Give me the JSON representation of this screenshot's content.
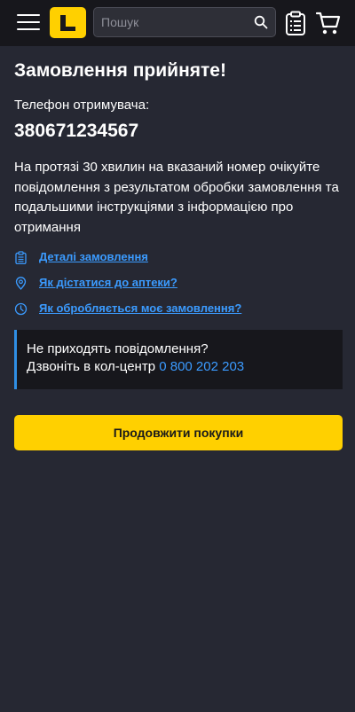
{
  "header": {
    "search": {
      "placeholder": "Пошук",
      "value": ""
    },
    "icons": {
      "menu": "hamburger-icon",
      "logo": "brand-logo",
      "search": "search-icon",
      "orders": "clipboard-list-icon",
      "cart": "cart-icon"
    }
  },
  "main": {
    "title": "Замовлення прийняте!",
    "phone_label": "Телефон отримувача:",
    "phone_number": "380671234567",
    "message": "На протязі 30 хвилин на вказаний номер очікуйте повідомлення з результатом обробки замовлення та подальшими інструкціями з інформацією про отримання",
    "links": [
      {
        "label": "Деталі замовлення",
        "icon": "clipboard-icon"
      },
      {
        "label": "Як дістатися до аптеки?",
        "icon": "location-pin-icon"
      },
      {
        "label": "Як обробляється моє замовлення?",
        "icon": "clock-icon"
      }
    ],
    "notice": {
      "line1": "Не приходять повідомлення?",
      "line2_text": "Дзвоніть в кол-центр",
      "phone": "0 800 202 203"
    },
    "continue_button": "Продовжити покупки"
  },
  "colors": {
    "background": "#262833",
    "header": "#17171c",
    "accent_yellow": "#ffd000",
    "link_blue": "#3b9bff"
  }
}
